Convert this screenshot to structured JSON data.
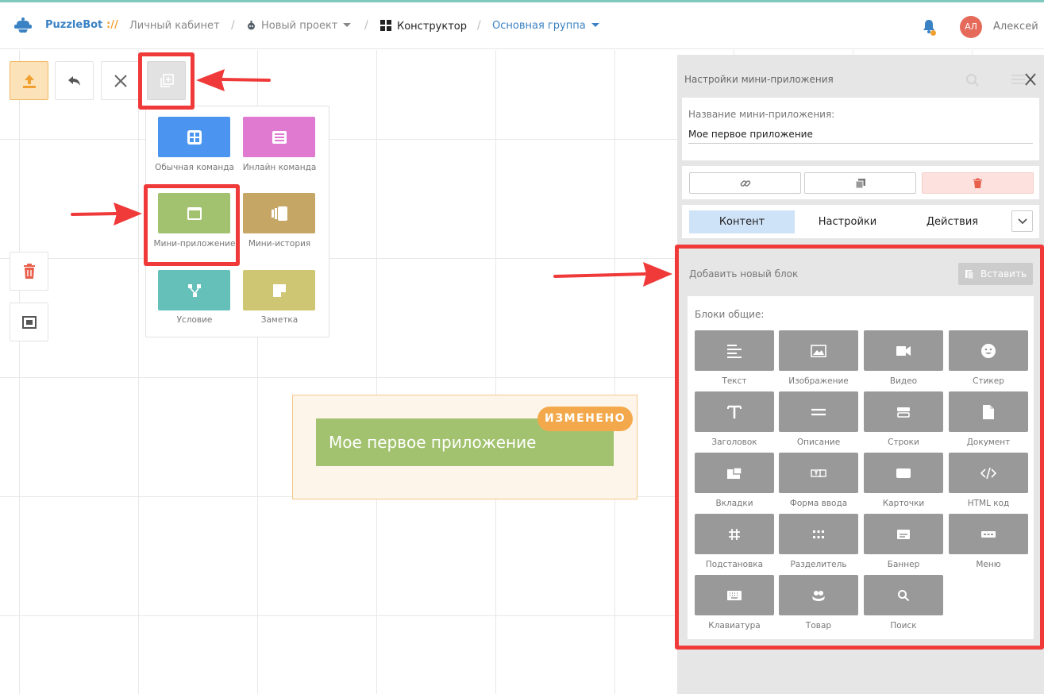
{
  "topbar": {
    "brand": "PuzzleBot",
    "brand_sep": "://",
    "crumb_cabinet": "Личный кабинет",
    "crumb_project": "Новый проект",
    "crumb_constructor": "Конструктор",
    "crumb_group": "Основная группа",
    "avatar_initials": "АЛ",
    "username": "Алексей"
  },
  "popup": {
    "items": [
      {
        "label": "Обычная команда",
        "color": "#4b95f0",
        "icon": "grid-icon"
      },
      {
        "label": "Инлайн команда",
        "color": "#e07ad0",
        "icon": "inline-list-icon"
      },
      {
        "label": "Мини-приложение",
        "color": "#a2c26f",
        "icon": "window-icon"
      },
      {
        "label": "Мини-история",
        "color": "#c5a665",
        "icon": "stories-icon"
      },
      {
        "label": "Условие",
        "color": "#65c0b9",
        "icon": "branch-icon"
      },
      {
        "label": "Заметка",
        "color": "#cfc673",
        "icon": "note-icon"
      }
    ]
  },
  "node": {
    "title": "Мое первое приложение",
    "badge": "ИЗМЕНЕНО"
  },
  "panel": {
    "title": "Настройки мини-приложения",
    "name_label": "Название мини-приложения:",
    "name_value": "Мое первое приложение",
    "tabs": [
      "Контент",
      "Настройки",
      "Действия"
    ],
    "add_block_title": "Добавить новый блок",
    "paste_label": "Вставить",
    "blocks_title": "Блоки общие:",
    "blocks": [
      {
        "label": "Текст",
        "icon": "text-align-icon"
      },
      {
        "label": "Изображение",
        "icon": "image-icon"
      },
      {
        "label": "Видео",
        "icon": "video-icon"
      },
      {
        "label": "Стикер",
        "icon": "smiley-icon"
      },
      {
        "label": "Заголовок",
        "icon": "heading-icon"
      },
      {
        "label": "Описание",
        "icon": "description-icon"
      },
      {
        "label": "Строки",
        "icon": "rows-icon"
      },
      {
        "label": "Документ",
        "icon": "document-icon"
      },
      {
        "label": "Вкладки",
        "icon": "tabs-icon"
      },
      {
        "label": "Форма ввода",
        "icon": "input-form-icon"
      },
      {
        "label": "Карточки",
        "icon": "cards-icon"
      },
      {
        "label": "HTML код",
        "icon": "code-icon"
      },
      {
        "label": "Подстановка",
        "icon": "hashtag-icon"
      },
      {
        "label": "Разделитель",
        "icon": "dots-grid-icon"
      },
      {
        "label": "Баннер",
        "icon": "banner-icon"
      },
      {
        "label": "Меню",
        "icon": "menu-dots-icon"
      },
      {
        "label": "Клавиатура",
        "icon": "keyboard-icon"
      },
      {
        "label": "Товар",
        "icon": "product-icon"
      },
      {
        "label": "Поиск",
        "icon": "search-icon"
      }
    ]
  },
  "colors": {
    "accent_blue": "#3b82c4",
    "accent_orange": "#f3a94b",
    "node_green": "#a2c26f",
    "highlight_red": "#f03a3a",
    "tile_gray": "#999999",
    "delete_red": "#e8604c"
  }
}
